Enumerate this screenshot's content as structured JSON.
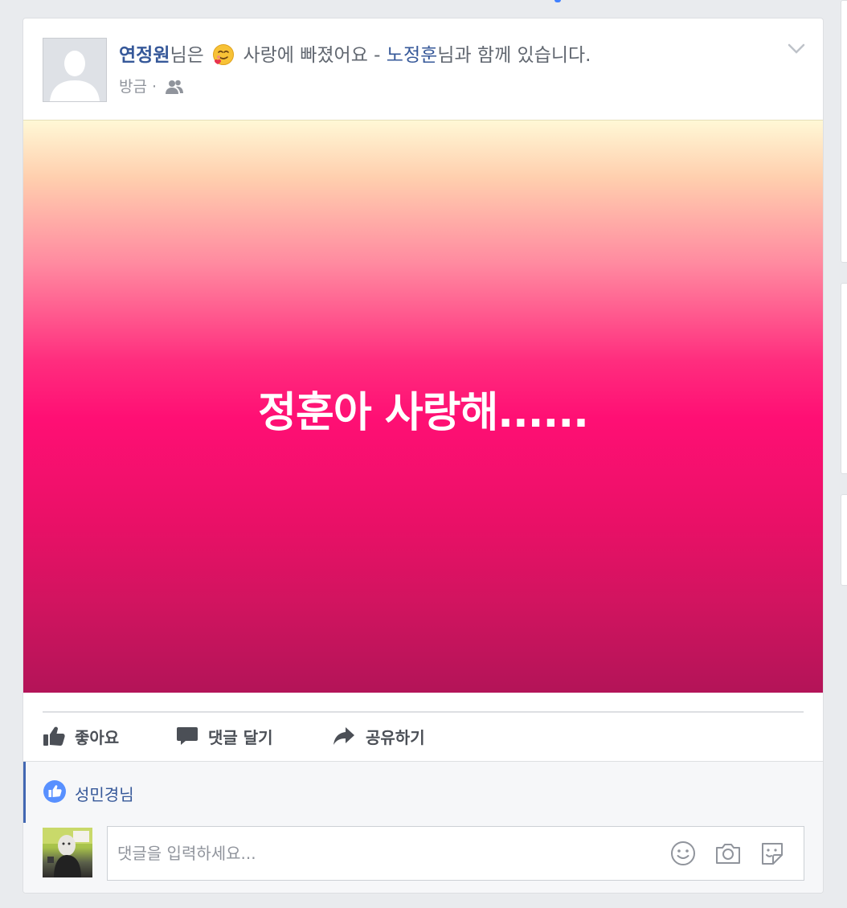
{
  "post": {
    "author": "연정원",
    "author_suffix": "님은",
    "feeling_text": "사랑에 빠졌어요 -",
    "tagged": "노정훈",
    "tagged_suffix": "님과 함께 있습니다.",
    "time": "방금",
    "separator": "·",
    "audience_icon": "friends-icon",
    "feeling_icon": "in-love-emoji-icon",
    "banner_text": "정훈아 사랑해......"
  },
  "actions": {
    "like": "좋아요",
    "comment": "댓글 달기",
    "share": "공유하기"
  },
  "reactions": {
    "liked_by": "성민경님"
  },
  "comment": {
    "placeholder": "댓글을 입력하세요...",
    "icons": [
      "emoji-icon",
      "camera-icon",
      "sticker-icon"
    ]
  },
  "colors": {
    "link": "#365899",
    "accent": "#4267b2",
    "banner_mid": "#ff0f74"
  }
}
